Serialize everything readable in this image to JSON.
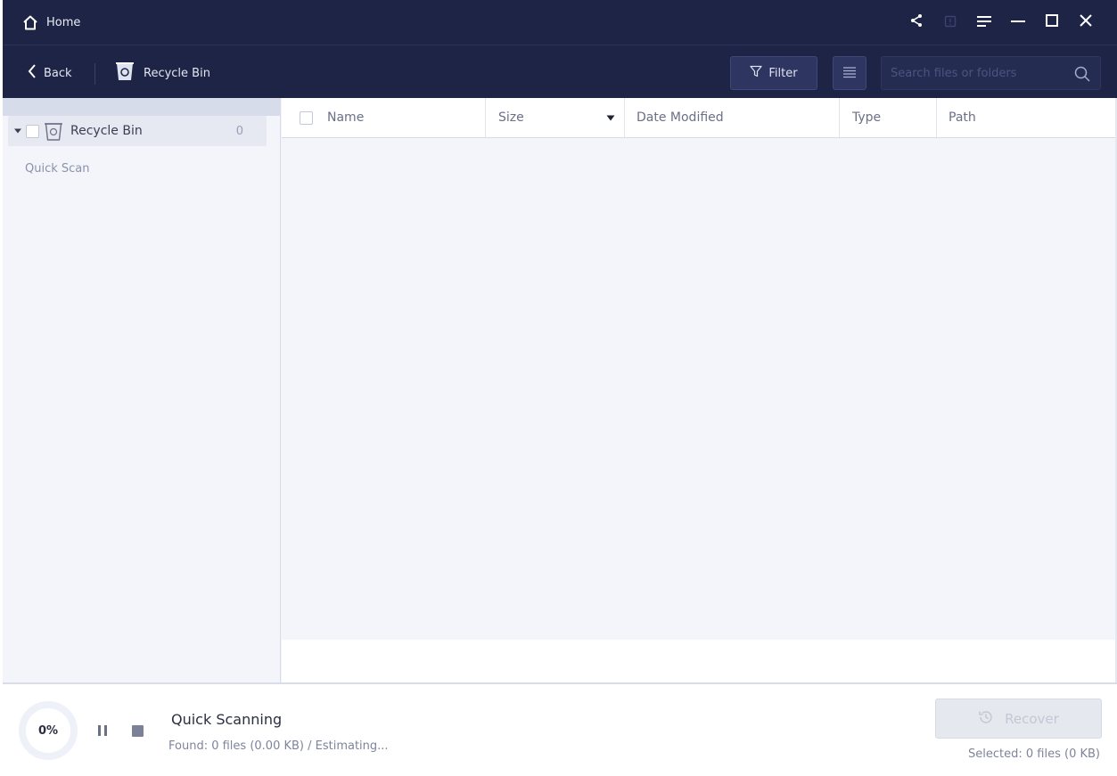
{
  "titlebar": {
    "home_label": "Home",
    "icons": [
      "share-icon",
      "feedback-icon",
      "menu-icon",
      "minimize-icon",
      "maximize-icon",
      "close-icon"
    ]
  },
  "toolbar": {
    "back_label": "Back",
    "breadcrumb_label": "Recycle Bin",
    "filter_label": "Filter",
    "search_placeholder": "Search files or folders"
  },
  "sidebar": {
    "tree": [
      {
        "label": "Recycle Bin",
        "count": "0",
        "expanded": true,
        "checked": false
      }
    ],
    "section_label": "Quick Scan"
  },
  "table": {
    "columns": [
      "Name",
      "Size",
      "Date Modified",
      "Type",
      "Path"
    ],
    "sort_column": "Size",
    "rows": []
  },
  "status": {
    "progress": "0%",
    "title": "Quick Scanning",
    "found": "Found: 0 files (0.00 KB) / Estimating...",
    "recover_label": "Recover",
    "selected": "Selected: 0 files (0 KB)"
  },
  "colors": {
    "header_bg": "#1e2445",
    "content_bg": "#f3f5fa",
    "recover_disabled": "#e5e8ef"
  }
}
